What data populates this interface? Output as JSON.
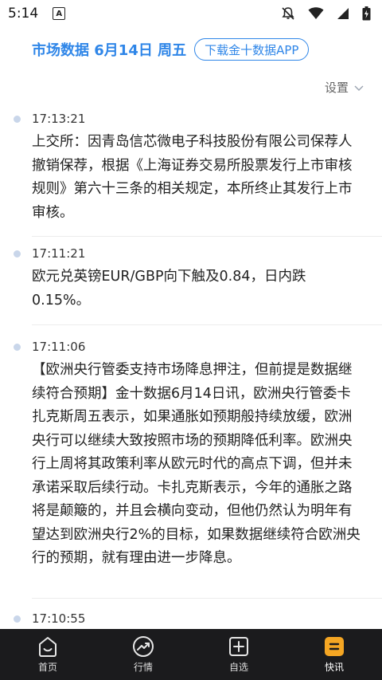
{
  "status_bar": {
    "time": "5:14",
    "app_indicator": "A",
    "icons": [
      "mute-icon",
      "wifi-icon",
      "signal-icon",
      "battery-icon"
    ]
  },
  "header": {
    "title": "市场数据 6月14日 周五",
    "download_button": "下载金十数据APP"
  },
  "settings": {
    "label": "设置"
  },
  "news": [
    {
      "time": "17:13:21",
      "text": "上交所：因青岛信芯微电子科技股份有限公司保荐人撤销保荐，根据《上海证券交易所股票发行上市审核规则》第六十三条的相关规定，本所终止其发行上市审核。"
    },
    {
      "time": "17:11:21",
      "text": "欧元兑英镑EUR/GBP向下触及0.84，日内跌0.15%。"
    },
    {
      "time": "17:11:06",
      "text": "【欧洲央行管委支持市场降息押注，但前提是数据继续符合预期】金十数据6月14日讯，欧洲央行管委卡扎克斯周五表示，如果通胀如预期般持续放缓，欧洲央行可以继续大致按照市场的预期降低利率。欧洲央行上周将其政策利率从欧元时代的高点下调，但并未承诺采取后续行动。卡扎克斯表示，今年的通胀之路将是颠簸的，并且会横向变动，但他仍然认为明年有望达到欧洲央行2%的目标，如果数据继续符合欧洲央行的预期，就有理由进一步降息。"
    },
    {
      "time": "17:10:55",
      "text": ""
    }
  ],
  "bottom_nav": {
    "items": [
      {
        "label": "首页",
        "icon": "home-icon"
      },
      {
        "label": "行情",
        "icon": "market-icon"
      },
      {
        "label": "自选",
        "icon": "watchlist-icon"
      },
      {
        "label": "快讯",
        "icon": "flash-news-icon"
      }
    ],
    "active_index": 3
  },
  "colors": {
    "accent": "#2f86e8",
    "nav_bg": "#1b1b1d",
    "active_icon": "#f5a623"
  }
}
